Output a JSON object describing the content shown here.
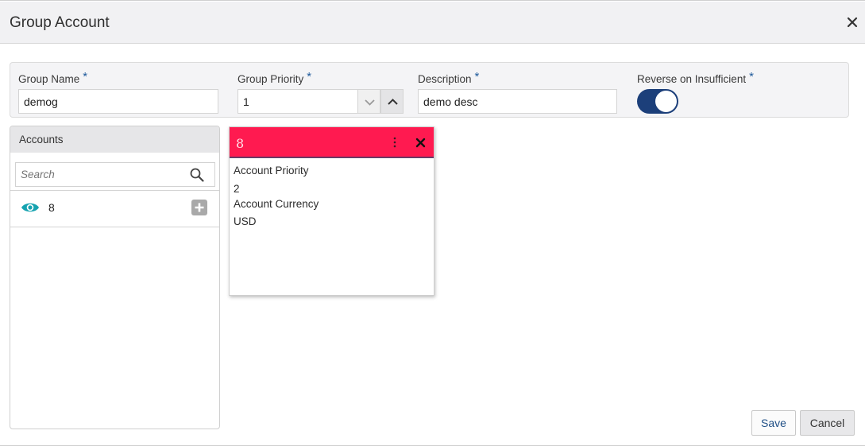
{
  "dialog": {
    "title": "Group Account"
  },
  "form": {
    "group_name": {
      "label": "Group Name",
      "required": "*",
      "value": "demog"
    },
    "group_priority": {
      "label": "Group Priority",
      "required": "*",
      "value": "1"
    },
    "description": {
      "label": "Description",
      "required": "*",
      "value": "demo desc"
    },
    "reverse_on_insufficient": {
      "label": "Reverse on Insufficient",
      "required": "*",
      "checked": true
    }
  },
  "accounts": {
    "header": "Accounts",
    "search": {
      "placeholder": "Search"
    },
    "items": [
      {
        "name": "8"
      }
    ]
  },
  "card": {
    "title": "8",
    "fields": [
      {
        "label": "Account Priority",
        "value": "2"
      },
      {
        "label": "Account Currency",
        "value": "USD"
      }
    ]
  },
  "actions": {
    "save": "Save",
    "cancel": "Cancel"
  },
  "colors": {
    "card_header": "#ff1a50",
    "toggle_on": "#1c3f7a",
    "eye_icon": "#16a3b0",
    "required": "#1f5a9b"
  }
}
